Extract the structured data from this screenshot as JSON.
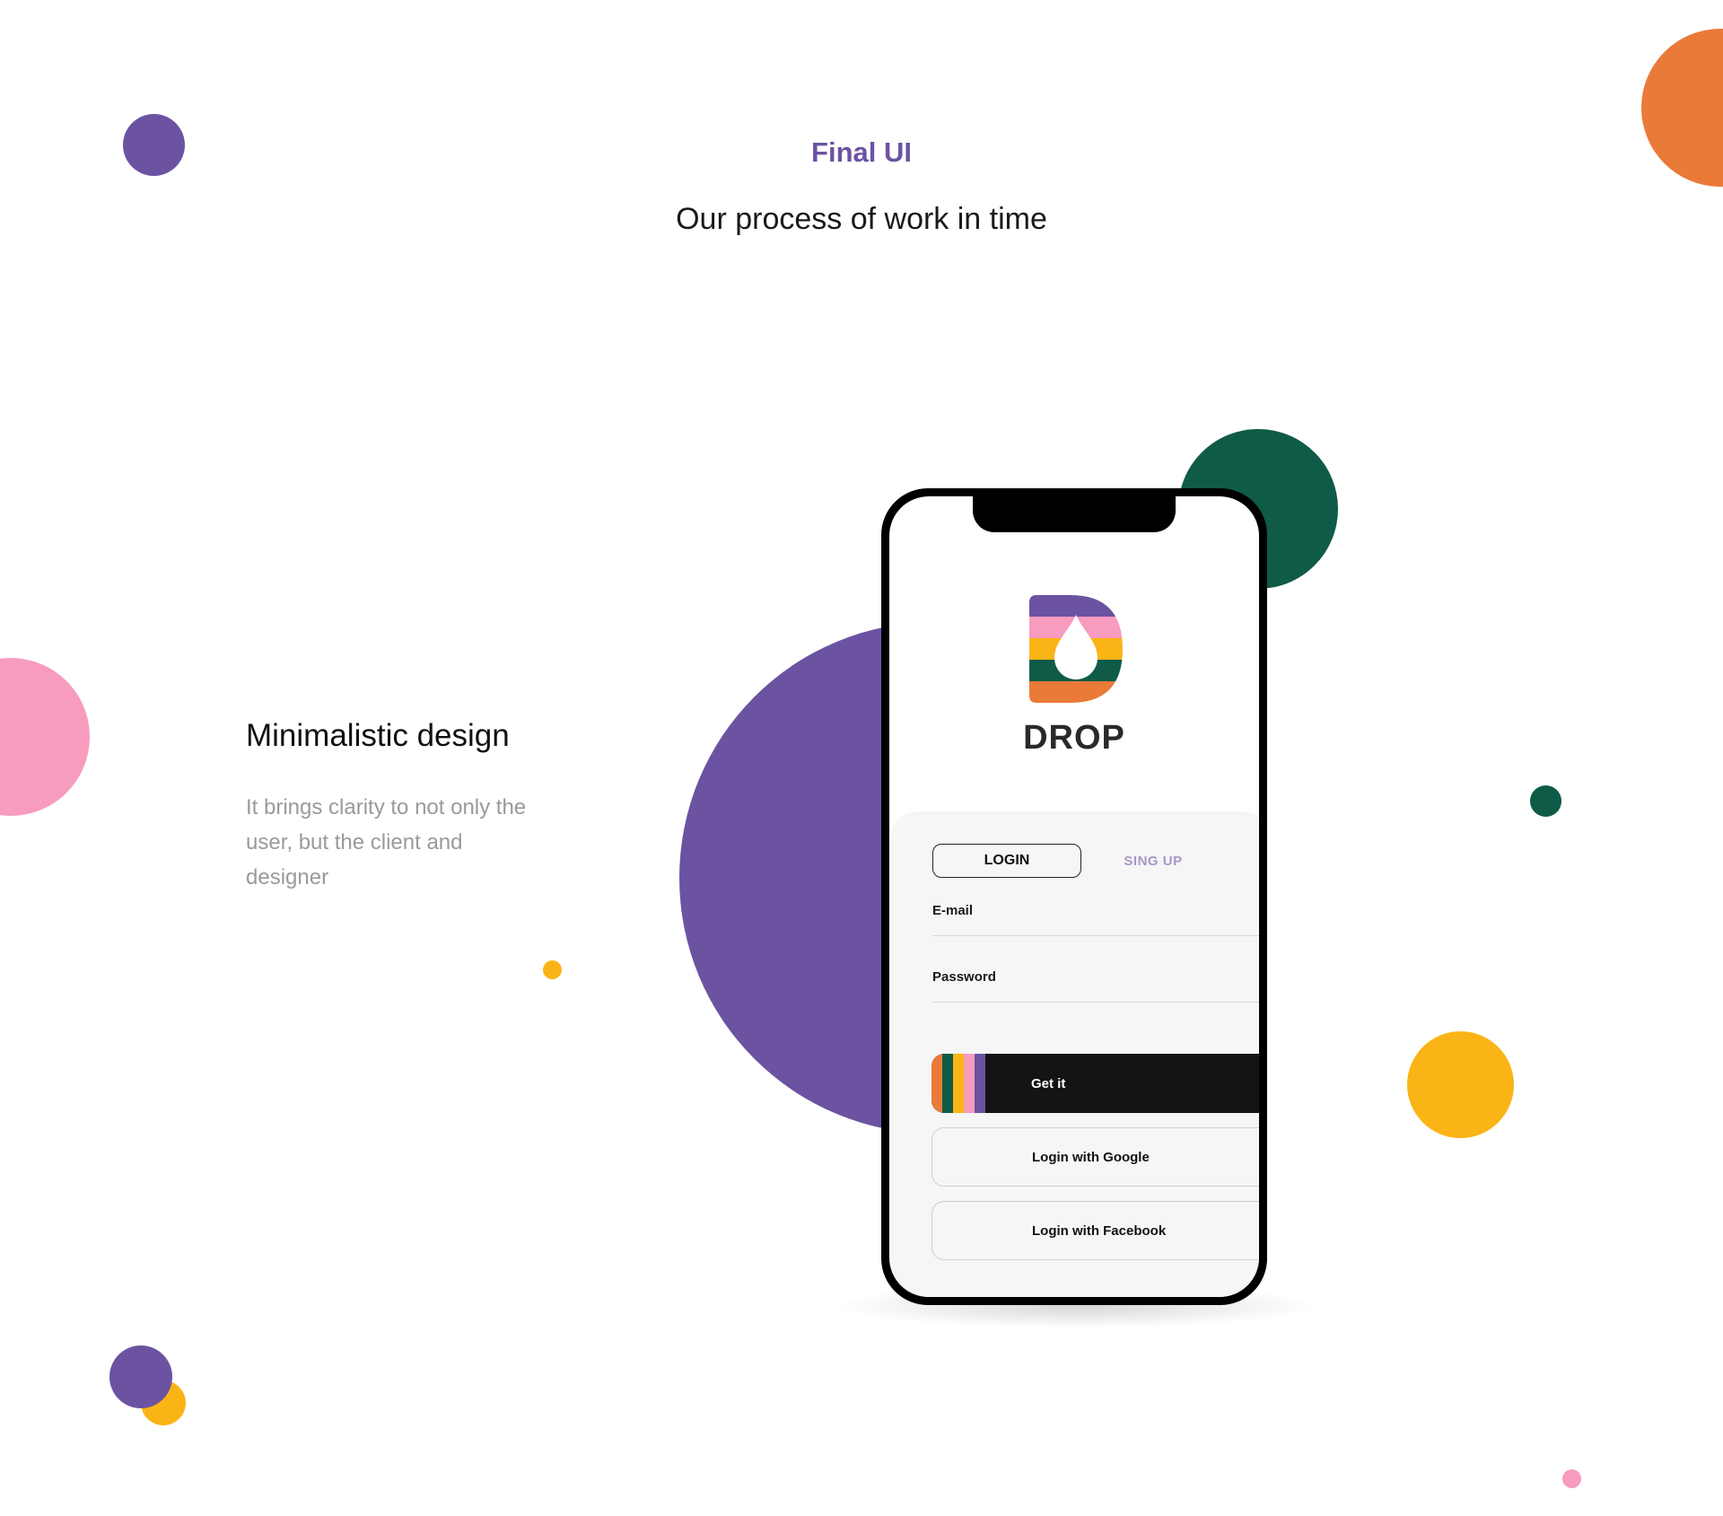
{
  "header": {
    "eyebrow": "Final UI",
    "headline": "Our process of work in time"
  },
  "feature": {
    "title": "Minimalistic design",
    "description": "It brings clarity to not only the user, but the client and designer"
  },
  "app": {
    "brand": "DROP",
    "tabs": {
      "login": "LOGIN",
      "signup": "SING UP"
    },
    "fields": {
      "email_label": "E-mail",
      "password_label": "Password"
    },
    "buttons": {
      "primary": "Get it",
      "google": "Login with Google",
      "facebook": "Login with Facebook"
    }
  },
  "colors": {
    "purple": "#6b53a2",
    "green": "#0f5b47",
    "orange": "#ea7a38",
    "yellow": "#fbb416",
    "pink": "#f79cbf",
    "dark": "#141414"
  }
}
